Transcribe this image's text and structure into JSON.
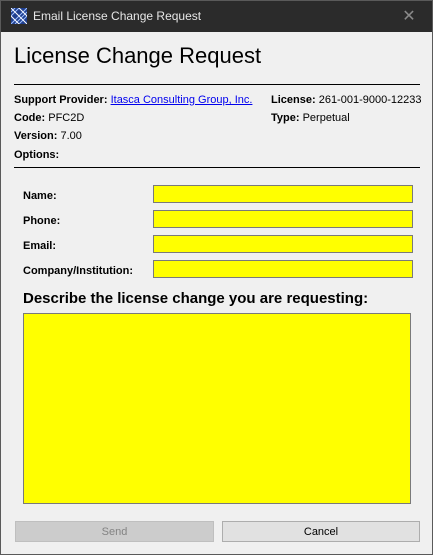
{
  "window": {
    "title": "Email License Change Request",
    "close_glyph": "✕"
  },
  "header": {
    "title": "License Change Request"
  },
  "info": {
    "support_provider_label": "Support Provider:",
    "support_provider_value": "Itasca Consulting Group, Inc.",
    "code_label": "Code:",
    "code_value": "PFC2D",
    "version_label": "Version:",
    "version_value": "7.00",
    "options_label": "Options:",
    "license_label": "License:",
    "license_value": "261-001-9000-12233",
    "type_label": "Type:",
    "type_value": "Perpetual"
  },
  "form": {
    "name_label": "Name:",
    "phone_label": "Phone:",
    "email_label": "Email:",
    "company_label": "Company/Institution:",
    "name_value": "",
    "phone_value": "",
    "email_value": "",
    "company_value": "",
    "describe_label": "Describe the license change you are requesting:",
    "describe_value": ""
  },
  "buttons": {
    "send_label": "Send",
    "cancel_label": "Cancel"
  },
  "colors": {
    "field_background": "#ffff00",
    "titlebar": "#2b2b2b",
    "link": "#0000ee"
  }
}
